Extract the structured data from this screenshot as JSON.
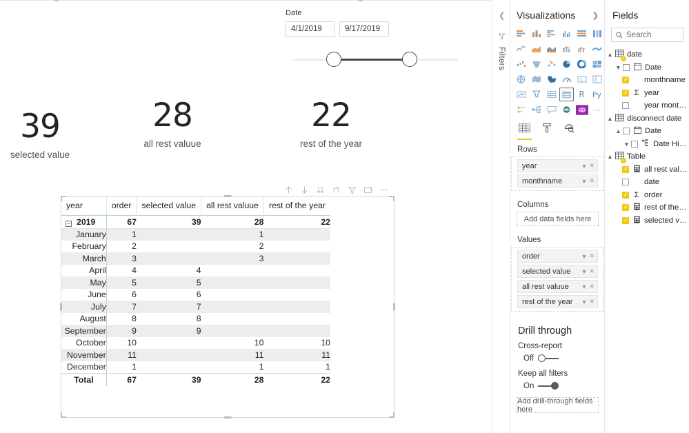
{
  "slicer": {
    "title": "Date",
    "start_value": "4/1/2019",
    "end_value": "9/17/2019"
  },
  "cards": [
    {
      "name": "selected-value",
      "value": "39",
      "label": "selected value"
    },
    {
      "name": "all-rest-valuue",
      "value": "28",
      "label": "all rest valuue"
    },
    {
      "name": "rest-of-the-year",
      "value": "22",
      "label": "rest  of the year"
    }
  ],
  "matrix": {
    "columns": [
      "year",
      "order",
      "selected value",
      "all rest valuue",
      "rest of the year"
    ],
    "year_row": {
      "label": "2019",
      "order": "67",
      "selected": "39",
      "all_rest": "28",
      "rest_year": "22"
    },
    "rows": [
      {
        "month": "January",
        "order": "1",
        "selected": "",
        "all_rest": "1",
        "rest_year": ""
      },
      {
        "month": "February",
        "order": "2",
        "selected": "",
        "all_rest": "2",
        "rest_year": ""
      },
      {
        "month": "March",
        "order": "3",
        "selected": "",
        "all_rest": "3",
        "rest_year": ""
      },
      {
        "month": "April",
        "order": "4",
        "selected": "4",
        "all_rest": "",
        "rest_year": ""
      },
      {
        "month": "May",
        "order": "5",
        "selected": "5",
        "all_rest": "",
        "rest_year": ""
      },
      {
        "month": "June",
        "order": "6",
        "selected": "6",
        "all_rest": "",
        "rest_year": ""
      },
      {
        "month": "July",
        "order": "7",
        "selected": "7",
        "all_rest": "",
        "rest_year": ""
      },
      {
        "month": "August",
        "order": "8",
        "selected": "8",
        "all_rest": "",
        "rest_year": ""
      },
      {
        "month": "September",
        "order": "9",
        "selected": "9",
        "all_rest": "",
        "rest_year": ""
      },
      {
        "month": "October",
        "order": "10",
        "selected": "",
        "all_rest": "10",
        "rest_year": "10"
      },
      {
        "month": "November",
        "order": "11",
        "selected": "",
        "all_rest": "11",
        "rest_year": "11"
      },
      {
        "month": "December",
        "order": "1",
        "selected": "",
        "all_rest": "1",
        "rest_year": "1"
      }
    ],
    "total_row": {
      "label": "Total",
      "order": "67",
      "selected": "39",
      "all_rest": "28",
      "rest_year": "22"
    }
  },
  "filters_rail": {
    "label": "Filters"
  },
  "visualizations": {
    "title": "Visualizations",
    "selected_visual": "matrix",
    "wells": {
      "rows_label": "Rows",
      "rows": [
        "year",
        "monthname"
      ],
      "columns_label": "Columns",
      "columns_placeholder": "Add data fields here",
      "values_label": "Values",
      "values": [
        "order",
        "selected value",
        "all rest valuue",
        "rest of the year"
      ]
    },
    "drill_through": {
      "title": "Drill through",
      "cross_report_label": "Cross-report",
      "cross_report_state": "Off",
      "keep_filters_label": "Keep all filters",
      "keep_filters_state": "On",
      "placeholder": "Add drill-through fields here"
    }
  },
  "fields": {
    "title": "Fields",
    "search_placeholder": "Search",
    "tree": [
      {
        "label": "date",
        "level": 1,
        "kind": "table",
        "checked": "badge"
      },
      {
        "label": "Date",
        "level": 2,
        "kind": "calendar",
        "checked": "unchecked"
      },
      {
        "label": "monthname",
        "level": 3,
        "kind": "none",
        "checked": "checked"
      },
      {
        "label": "year",
        "level": 3,
        "kind": "sigma",
        "checked": "checked"
      },
      {
        "label": "year month...",
        "level": 3,
        "kind": "none",
        "checked": "unchecked"
      },
      {
        "label": "disconnect date",
        "level": 1,
        "kind": "table",
        "checked": "none"
      },
      {
        "label": "Date",
        "level": 2,
        "kind": "calendar",
        "checked": "unchecked"
      },
      {
        "label": "Date Hier...",
        "level": 3,
        "kind": "hierarchy",
        "checked": "unchecked"
      },
      {
        "label": "Table",
        "level": 1,
        "kind": "table",
        "checked": "badge"
      },
      {
        "label": "all rest valu...",
        "level": 3,
        "kind": "measure",
        "checked": "checked"
      },
      {
        "label": "date",
        "level": 3,
        "kind": "none",
        "checked": "unchecked"
      },
      {
        "label": "order",
        "level": 3,
        "kind": "sigma",
        "checked": "checked"
      },
      {
        "label": "rest of the y...",
        "level": 3,
        "kind": "measure",
        "checked": "checked"
      },
      {
        "label": "selected val...",
        "level": 3,
        "kind": "measure",
        "checked": "checked"
      }
    ]
  },
  "colors": {
    "accent_yellow": "#f2c811",
    "header_rule": "#b9d2e0",
    "band": "#ededed",
    "text": "#252423"
  }
}
